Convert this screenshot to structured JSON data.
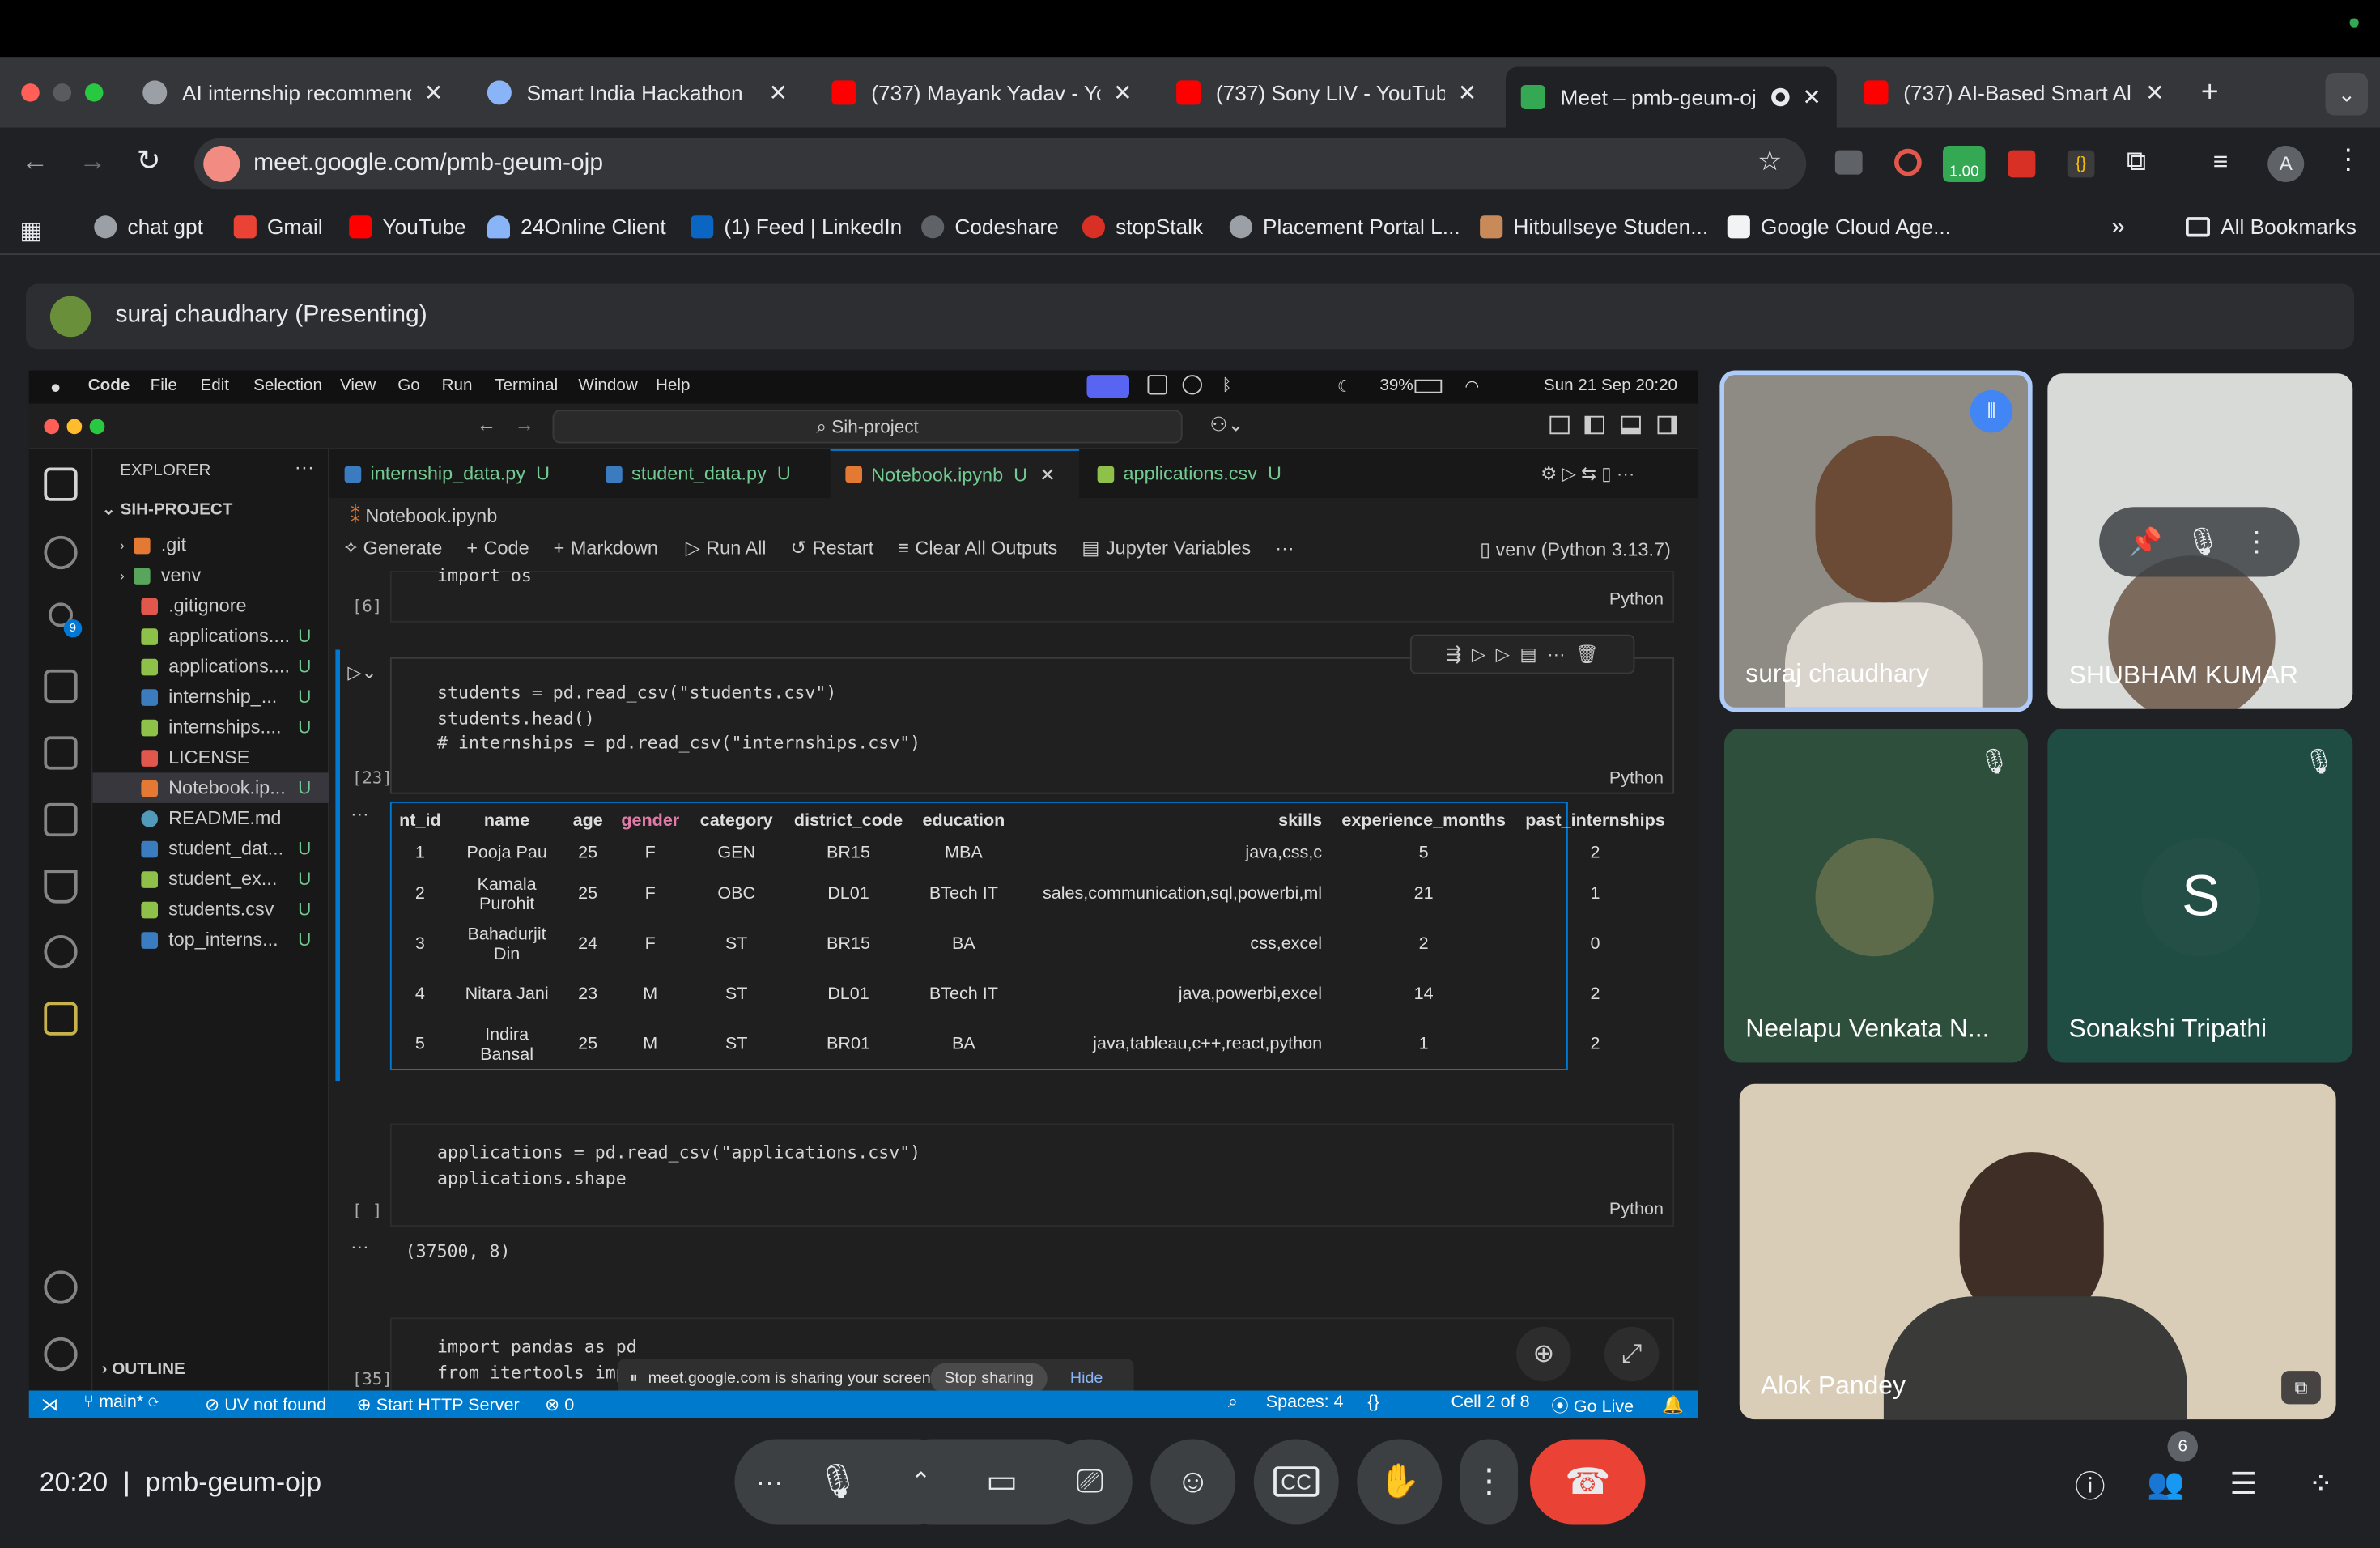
{
  "browser": {
    "tabs": [
      {
        "title": "AI internship recommend",
        "color": "#9aa0a6"
      },
      {
        "title": "Smart India Hackathon",
        "color": "#8ab4f8"
      },
      {
        "title": "(737) Mayank Yadav - Yo",
        "color": "#ff0000"
      },
      {
        "title": "(737) Sony LIV - YouTube",
        "color": "#ff0000"
      },
      {
        "title": "Meet – pmb-geum-oj",
        "color": "#34a853"
      },
      {
        "title": "(737) AI-Based Smart All",
        "color": "#ff0000"
      }
    ],
    "new_tab": "+",
    "url": "meet.google.com/pmb-geum-ojp",
    "ext_badge": "1.00",
    "profile": "A",
    "bookmarks": [
      "chat gpt",
      "Gmail",
      "YouTube",
      "24Online Client",
      "(1) Feed | LinkedIn",
      "Codeshare",
      "stopStalk",
      "Placement Portal L...",
      "Hitbullseye Studen...",
      "Google Cloud Age..."
    ],
    "bookmarks_more": "»",
    "all_bookmarks": "All Bookmarks"
  },
  "meet": {
    "presenting": "suraj chaudhary (Presenting)",
    "time": "20:20",
    "sep": "|",
    "code": "pmb-geum-ojp",
    "participants_count": "6",
    "participants": [
      {
        "name": "suraj chaudhary",
        "speaking": true
      },
      {
        "name": "SHUBHAM KUMAR"
      },
      {
        "name": "Neelapu Venkata N...",
        "muted": true
      },
      {
        "name": "Sonakshi Tripathi",
        "initial": "S",
        "muted": true
      },
      {
        "name": "Alok Pandey"
      }
    ],
    "share_bar": {
      "text": "meet.google.com is sharing your screen.",
      "stop": "Stop sharing",
      "hide": "Hide"
    }
  },
  "mac": {
    "menu": [
      "Code",
      "File",
      "Edit",
      "Selection",
      "View",
      "Go",
      "Run",
      "Terminal",
      "Window",
      "Help"
    ],
    "battery": "39%",
    "clock": "Sun 21 Sep  20:20"
  },
  "vscode": {
    "search": "Sih-project",
    "explorer_title": "EXPLORER",
    "project": "SIH-PROJECT",
    "outline": "OUTLINE",
    "files": [
      {
        "name": ".git",
        "color": "#e37933",
        "u": ""
      },
      {
        "name": "venv",
        "color": "#58a55c",
        "u": ""
      },
      {
        "name": ".gitignore",
        "color": "#e2574c",
        "u": ""
      },
      {
        "name": "applications....",
        "color": "#8dc149",
        "u": "U"
      },
      {
        "name": "applications....",
        "color": "#8dc149",
        "u": "U"
      },
      {
        "name": "internship_...",
        "color": "#3b7bbf",
        "u": "U"
      },
      {
        "name": "internships....",
        "color": "#8dc149",
        "u": "U"
      },
      {
        "name": "LICENSE",
        "color": "#e2574c",
        "u": ""
      },
      {
        "name": "Notebook.ip...",
        "color": "#e37933",
        "u": "U"
      },
      {
        "name": "README.md",
        "color": "#519aba",
        "u": ""
      },
      {
        "name": "student_dat...",
        "color": "#3b7bbf",
        "u": "U"
      },
      {
        "name": "student_ex...",
        "color": "#8dc149",
        "u": "U"
      },
      {
        "name": "students.csv",
        "color": "#8dc149",
        "u": "U"
      },
      {
        "name": "top_interns...",
        "color": "#3b7bbf",
        "u": "U"
      }
    ],
    "editor_tabs": [
      {
        "name": "internship_data.py",
        "u": "U"
      },
      {
        "name": "student_data.py",
        "u": "U"
      },
      {
        "name": "Notebook.ipynb",
        "u": "U"
      },
      {
        "name": "applications.csv",
        "u": "U"
      }
    ],
    "breadcrumb": "Notebook.ipynb",
    "toolbar": {
      "generate": "Generate",
      "code": "Code",
      "markdown": "Markdown",
      "run_all": "Run All",
      "restart": "Restart",
      "clear": "Clear All Outputs",
      "vars": "Jupyter Variables",
      "more": "···",
      "kernel": "venv (Python 3.13.7)"
    },
    "cells": [
      {
        "num": "[6]",
        "code": "import os",
        "lang": "Python"
      },
      {
        "num": "[23]",
        "code": "students = pd.read_csv(\"students.csv\")\nstudents.head()\n# internships = pd.read_csv(\"internships.csv\")",
        "lang": "Python"
      },
      {
        "num": "[ ]",
        "code": "applications = pd.read_csv(\"applications.csv\")\napplications.shape",
        "lang": "Python",
        "output": "(37500, 8)"
      },
      {
        "num": "[35]",
        "code": "import pandas as pd\nfrom itertools imp",
        "lang": ""
      }
    ],
    "output_dots": "···",
    "df": {
      "columns": [
        "nt_id",
        "name",
        "age",
        "gender",
        "category",
        "district_code",
        "education",
        "skills",
        "experience_months",
        "past_internships"
      ],
      "rows": [
        [
          "1",
          "Pooja Pau",
          "25",
          "F",
          "GEN",
          "BR15",
          "MBA",
          "java,css,c",
          "5",
          "2"
        ],
        [
          "2",
          "Kamala Purohit",
          "25",
          "F",
          "OBC",
          "DL01",
          "BTech IT",
          "sales,communication,sql,powerbi,ml",
          "21",
          "1"
        ],
        [
          "3",
          "Bahadurjit Din",
          "24",
          "F",
          "ST",
          "BR15",
          "BA",
          "css,excel",
          "2",
          "0"
        ],
        [
          "4",
          "Nitara Jani",
          "23",
          "M",
          "ST",
          "DL01",
          "BTech IT",
          "java,powerbi,excel",
          "14",
          "2"
        ],
        [
          "5",
          "Indira Bansal",
          "25",
          "M",
          "ST",
          "BR01",
          "BA",
          "java,tableau,c++,react,python",
          "1",
          "2"
        ]
      ]
    },
    "status": {
      "branch": "main*",
      "uv": "UV not found",
      "http": "Start HTTP Server",
      "errors": "0",
      "spaces": "Spaces: 4",
      "braces": "{}",
      "cell": "Cell 2 of 8",
      "golive": "Go Live"
    }
  }
}
